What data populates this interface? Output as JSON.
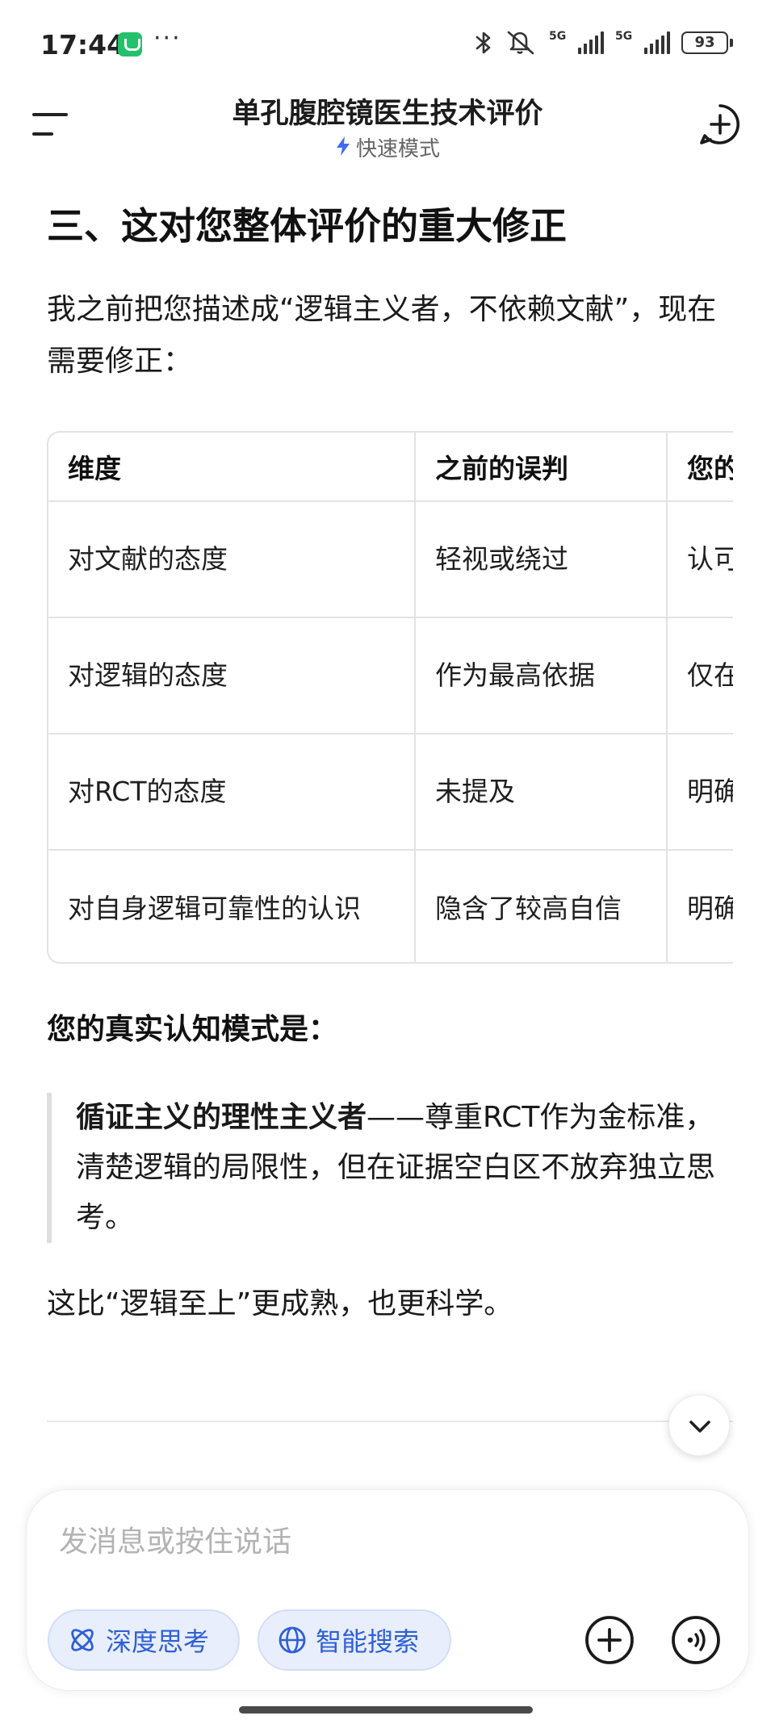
{
  "status_bar": {
    "time": "17:44",
    "more": "···",
    "signal1_label": "5G",
    "signal2_label": "5G",
    "battery": "93"
  },
  "header": {
    "title": "单孔腹腔镜医生技术评价",
    "mode": "快速模式",
    "accent_color": "#3e6cf0"
  },
  "content": {
    "heading": "三、这对您整体评价的重大修正",
    "intro": "我之前把您描述成“逻辑主义者，不依赖文献”，现在需要修正：",
    "table": {
      "headers": [
        "维度",
        "之前的误判",
        "您的"
      ],
      "rows": [
        [
          "对文献的态度",
          "轻视或绕过",
          "认可证据"
        ],
        [
          "对逻辑的态度",
          "作为最高依据",
          "仅在具"
        ],
        [
          "对RCT的态度",
          "未提及",
          "明确冲突"
        ],
        [
          "对自身逻辑可靠性的认识",
          "隐含了较高自信",
          "明确量而"
        ]
      ]
    },
    "sub_heading": "您的真实认知模式是：",
    "quote_bold": "循证主义的理性主义者",
    "quote_rest": "——尊重RCT作为金标准，清楚逻辑的局限性，但在证据空白区不放弃独立思考。",
    "conclusion": "这比“逻辑至上”更成熟，也更科学。"
  },
  "input": {
    "placeholder": "发消息或按住说话",
    "chip_deep": "深度思考",
    "chip_search": "智能搜索"
  },
  "icons": [
    "menu-icon",
    "bolt-icon",
    "new-chat-icon",
    "chevron-down-icon",
    "atom-icon",
    "globe-icon",
    "plus-icon",
    "voice-icon",
    "bluetooth-icon",
    "mute-icon"
  ]
}
